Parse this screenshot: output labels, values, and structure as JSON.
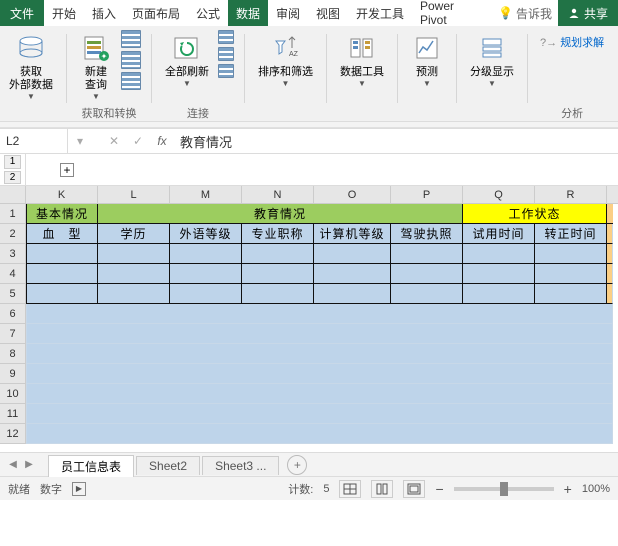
{
  "titlebar": {
    "file": "文件",
    "tabs": [
      "开始",
      "插入",
      "页面布局",
      "公式",
      "数据",
      "审阅",
      "视图",
      "开发工具",
      "Power Pivot"
    ],
    "active_index": 4,
    "tellme_icon": "bulb-icon",
    "tellme": "告诉我",
    "share": "共享"
  },
  "ribbon": {
    "get_data": "获取\n外部数据",
    "new_query": "新建\n查询",
    "refresh_all": "全部刷新",
    "sort_filter": "排序和筛选",
    "data_tools": "数据工具",
    "forecast": "预测",
    "outline": "分级显示",
    "solver": "规划求解",
    "group_labels": {
      "get_transform": "获取和转换",
      "connections": "连接",
      "analysis": "分析"
    }
  },
  "formula_bar": {
    "name_box": "L2",
    "formula": "教育情况"
  },
  "outline_levels": [
    "1",
    "2"
  ],
  "columns": [
    "K",
    "L",
    "M",
    "N",
    "O",
    "P",
    "Q",
    "R"
  ],
  "row_numbers": [
    "1",
    "2",
    "3",
    "4",
    "5",
    "6",
    "7",
    "8",
    "9",
    "10",
    "11",
    "12"
  ],
  "sections": {
    "basic": "基本情况",
    "education": "教育情况",
    "work": "工作状态"
  },
  "headers_row2": [
    "血　型",
    "学历",
    "外语等级",
    "专业职称",
    "计算机等级",
    "驾驶执照",
    "试用时间",
    "转正时间"
  ],
  "sheets": {
    "active": "员工信息表",
    "others": [
      "Sheet2",
      "Sheet3 ..."
    ]
  },
  "status": {
    "ready": "就绪",
    "mode": "数字",
    "count_label": "计数:",
    "count_value": "5",
    "zoom": "100%"
  }
}
